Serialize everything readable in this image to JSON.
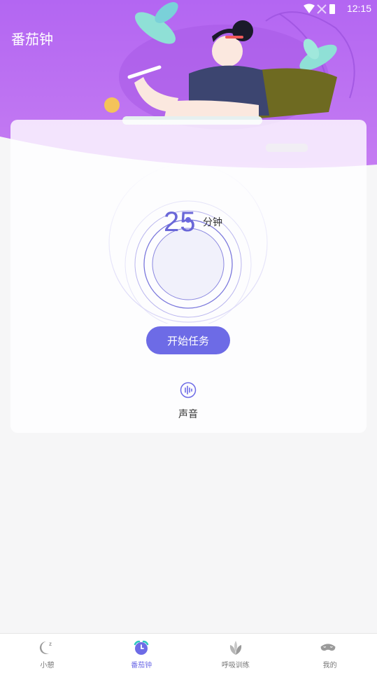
{
  "status_bar": {
    "time": "12:15"
  },
  "header": {
    "title": "番茄钟"
  },
  "timer": {
    "value": "25",
    "unit": "分钟"
  },
  "actions": {
    "start_label": "开始任务"
  },
  "sound": {
    "label": "声音"
  },
  "tabbar": {
    "items": [
      {
        "label": "小憩",
        "icon": "moon-icon"
      },
      {
        "label": "番茄钟",
        "icon": "alarm-clock-icon",
        "active": true
      },
      {
        "label": "呼吸训练",
        "icon": "leaf-icon"
      },
      {
        "label": "我的",
        "icon": "sleep-mask-icon"
      }
    ]
  },
  "colors": {
    "accent": "#6d6be6",
    "header_purple": "#b565f0"
  }
}
